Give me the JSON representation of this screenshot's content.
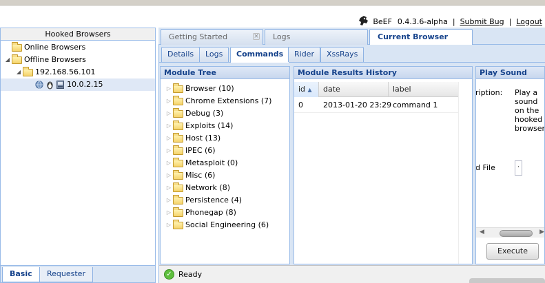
{
  "header": {
    "brand": "BeEF",
    "version": "0.4.3.6-alpha",
    "separator": "|",
    "links": {
      "submit_bug": "Submit Bug",
      "logout": "Logout"
    }
  },
  "left_panel": {
    "title": "Hooked Browsers",
    "tree": {
      "online": "Online Browsers",
      "offline": "Offline Browsers",
      "subnet": "192.168.56.101",
      "host": "10.0.2.15"
    },
    "bottom_tabs": [
      "Basic",
      "Requester"
    ]
  },
  "main_tabs": [
    "Getting Started",
    "Logs",
    "Current Browser"
  ],
  "sub_tabs": [
    "Details",
    "Logs",
    "Commands",
    "Rider",
    "XssRays"
  ],
  "module_tree": {
    "title": "Module Tree",
    "items": [
      "Browser (10)",
      "Chrome Extensions (7)",
      "Debug (3)",
      "Exploits (14)",
      "Host (13)",
      "IPEC (6)",
      "Metasploit (0)",
      "Misc (6)",
      "Network (8)",
      "Persistence (4)",
      "Phonegap (8)",
      "Social Engineering (6)"
    ]
  },
  "results": {
    "title": "Module Results History",
    "columns": [
      "id",
      "date",
      "label"
    ],
    "rows": [
      {
        "id": "0",
        "date": "2013-01-20 23:29",
        "label": "command 1"
      }
    ]
  },
  "play_sound": {
    "title": "Play Sound",
    "description_label": "ription:",
    "description_text": "Play a sound on the hooked browser.",
    "file_label": "d File",
    "file_value": "·",
    "execute_label": "Execute"
  },
  "status": {
    "text": "Ready"
  },
  "colors": {
    "accent": "#15428b",
    "panel_border": "#99bbe8",
    "ready_green": "#5fbf3e"
  }
}
